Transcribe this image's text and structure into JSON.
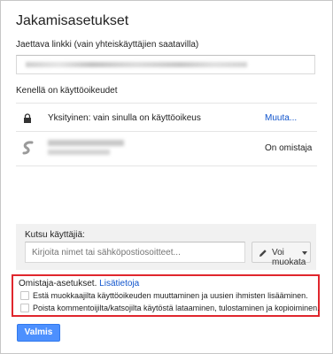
{
  "dialog": {
    "title": "Jakamisasetukset",
    "link_label": "Jaettava linkki (vain yhteiskäyttäjien saatavilla)",
    "access_label": "Kenellä on käyttöoikeudet"
  },
  "access": {
    "visibility": "Yksityinen: vain sinulla on käyttöoikeus",
    "change_link": "Muuta...",
    "owner_role": "On omistaja"
  },
  "invite": {
    "label": "Kutsu käyttäjiä:",
    "placeholder": "Kirjoita nimet tai sähköpostiosoitteet...",
    "permission": "Voi muokata"
  },
  "owner_settings": {
    "label": "Omistaja-asetukset.",
    "learn_more": "Lisätietoja",
    "option1": "Estä muokkaajilta käyttöoikeuden muuttaminen ja uusien ihmisten lisääminen.",
    "option2": "Poista kommentoijilta/katsojilta käytöstä lataaminen, tulostaminen ja kopioiminen."
  },
  "done_label": "Valmis",
  "colors": {
    "accent": "#4d90fe",
    "link": "#1155cc",
    "highlight_border": "#e0262d"
  }
}
